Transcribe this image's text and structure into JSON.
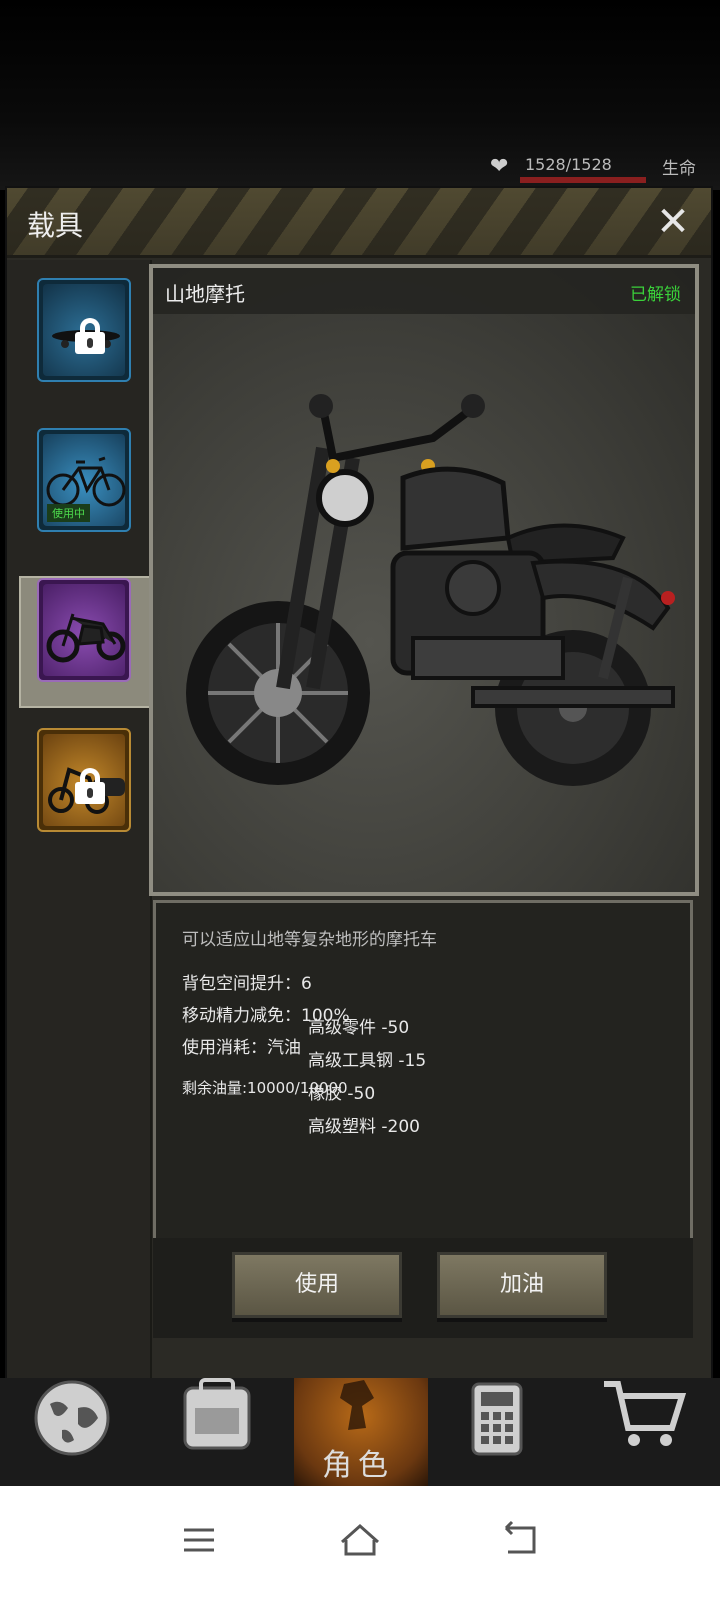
{
  "status": {
    "hp_text": "1528/1528",
    "life_label": "生命"
  },
  "panel": {
    "title": "载具"
  },
  "vehicles": [
    {
      "name": "skateboard",
      "locked": true,
      "color": "#1f4e6b"
    },
    {
      "name": "bicycle",
      "locked": false,
      "badge": "使用中",
      "color": "#2a6f96"
    },
    {
      "name": "mountain-motorcycle",
      "locked": false,
      "selected": true,
      "color": "#6b2f8f"
    },
    {
      "name": "sidecar-motorcycle",
      "locked": true,
      "color": "#8a5a18"
    }
  ],
  "viewer": {
    "vehicle_name": "山地摩托",
    "unlock_status": "已解锁"
  },
  "description": {
    "summary": "可以适应山地等复杂地形的摩托车",
    "bag_space": "背包空间提升：6",
    "stamina_reduction": "移动精力减免：100%",
    "consumption": "使用消耗：汽油",
    "fuel_remaining": "剩余油量:10000/10000",
    "costs": [
      "高级零件 -50",
      "高级工具钢 -15",
      "橡胶 -50",
      "高级塑料 -200"
    ]
  },
  "buttons": {
    "use": "使用",
    "refuel": "加油"
  },
  "nav": {
    "role_label": "角色",
    "items": [
      "globe-icon",
      "backpack-icon",
      "character-icon",
      "device-icon",
      "cart-icon"
    ]
  },
  "colors": {
    "unlocked_green": "#3ad13a",
    "in_use_green": "#4ddc4d",
    "hp_red": "#8a1f1f",
    "panel_bg": "#2b2a25"
  }
}
